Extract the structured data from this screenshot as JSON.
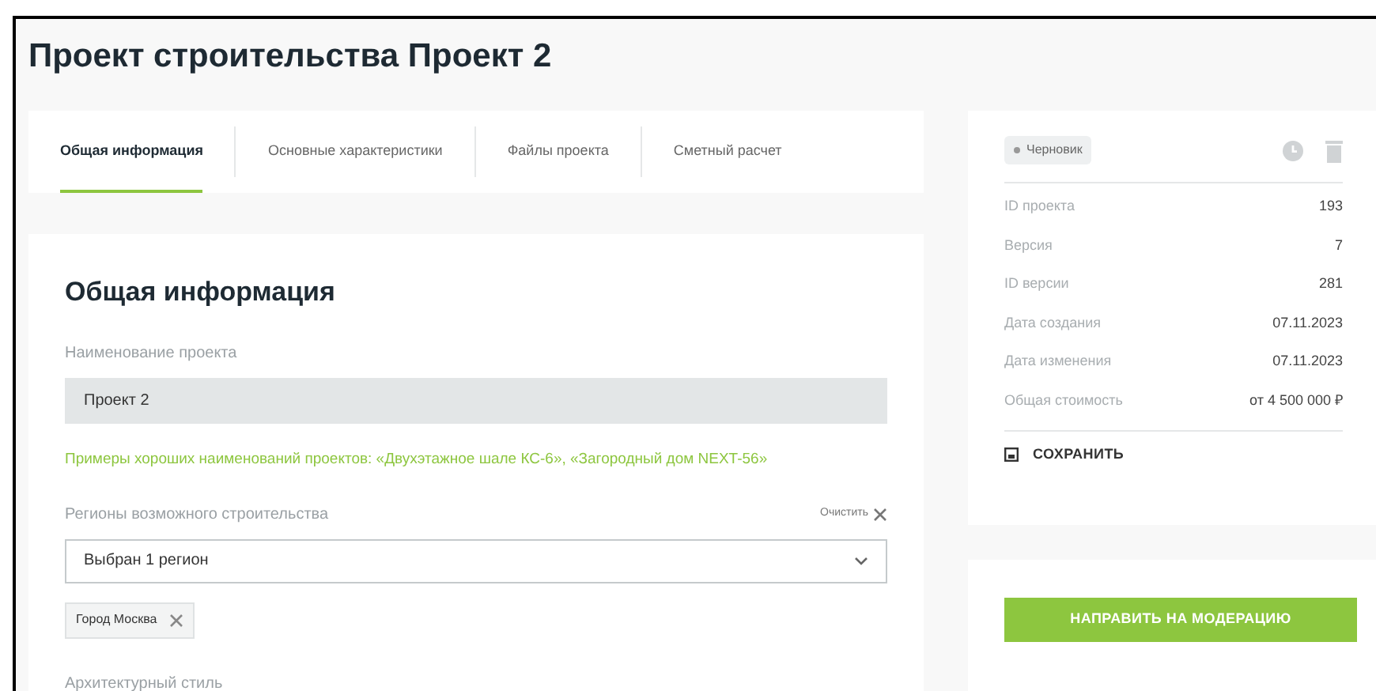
{
  "page_title": "Проект строительства Проект 2",
  "tabs": [
    {
      "label": "Общая информация",
      "selected": true
    },
    {
      "label": "Основные характеристики",
      "selected": false
    },
    {
      "label": "Файлы проекта",
      "selected": false
    },
    {
      "label": "Сметный расчет",
      "selected": false
    }
  ],
  "form": {
    "heading": "Общая информация",
    "name_field": {
      "label": "Наименование проекта",
      "value": "Проект 2",
      "disabled": true
    },
    "hint": "Примеры хороших наименований проектов: «Двухэтажное шале КС-6», «Загородный дом NEXT-56»",
    "regions": {
      "label": "Регионы возможного строительства",
      "clear": "Очистить",
      "value": "Выбран 1 регион",
      "tags": [
        "Город Москва"
      ]
    },
    "next_label": "Архитектурный стиль"
  },
  "sidebar": {
    "status": "Черновик",
    "details": [
      {
        "label": "ID проекта",
        "value": "193"
      },
      {
        "label": "Версия",
        "value": "7"
      },
      {
        "label": "ID версии",
        "value": "281"
      },
      {
        "label": "Дата создания",
        "value": "07.11.2023"
      },
      {
        "label": "Дата изменения",
        "value": "07.11.2023"
      },
      {
        "label": "Общая стоимость",
        "value": "от 4 500 000 ₽"
      }
    ],
    "save": "СОХРАНИТЬ",
    "submit": "НАПРАВИТЬ НА МОДЕРАЦИЮ"
  }
}
